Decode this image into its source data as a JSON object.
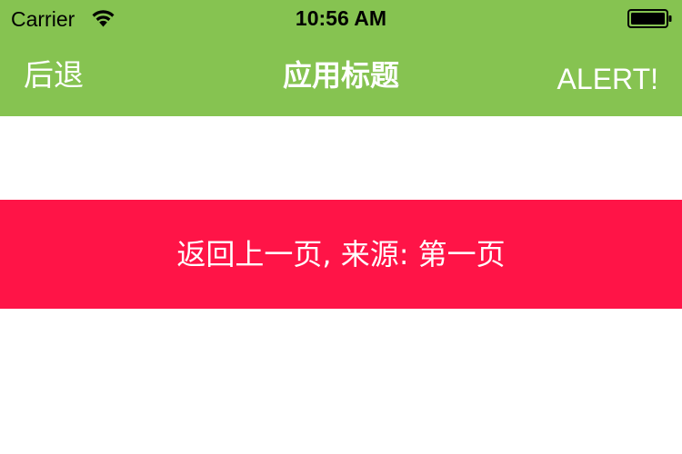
{
  "status_bar": {
    "carrier": "Carrier",
    "time": "10:56 AM",
    "wifi_icon": "wifi-icon",
    "battery_icon": "battery-icon"
  },
  "nav_bar": {
    "back_label": "后退",
    "title": "应用标题",
    "right_label": "ALERT!"
  },
  "content": {
    "back_banner_label": "返回上一页, 来源: 第一页"
  },
  "colors": {
    "header_green": "#86c351",
    "banner_red": "#ff1447",
    "text_white": "#ffffff",
    "background": "#ffffff"
  }
}
